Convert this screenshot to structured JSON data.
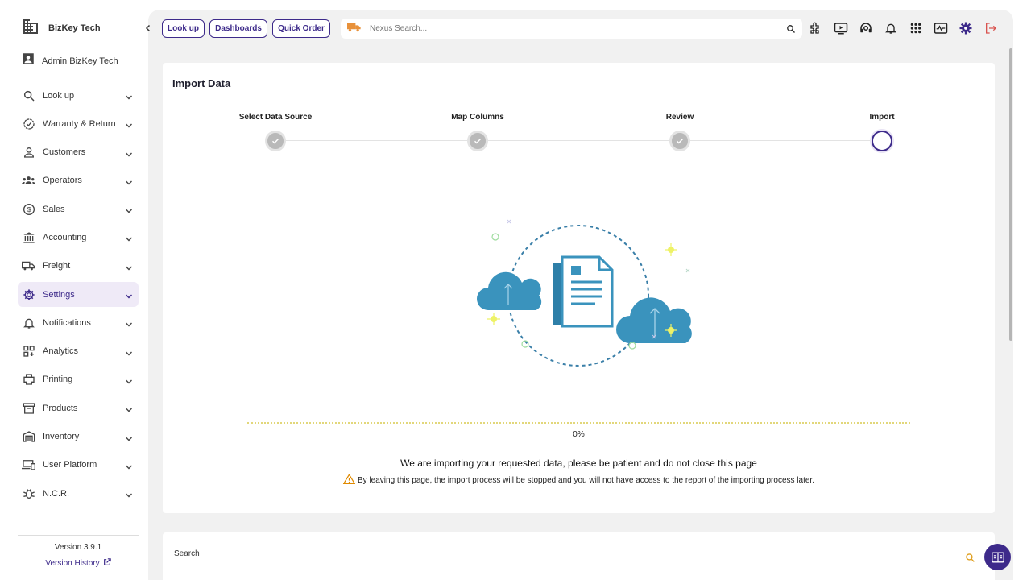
{
  "brand": {
    "name": "BizKey Tech"
  },
  "user": {
    "name": "Admin BizKey Tech"
  },
  "sidebar": {
    "items": [
      {
        "label": "Look up",
        "icon": "search-icon"
      },
      {
        "label": "Warranty & Return",
        "icon": "badge-check-icon"
      },
      {
        "label": "Customers",
        "icon": "person-icon"
      },
      {
        "label": "Operators",
        "icon": "group-icon"
      },
      {
        "label": "Sales",
        "icon": "dollar-icon"
      },
      {
        "label": "Accounting",
        "icon": "bank-icon"
      },
      {
        "label": "Freight",
        "icon": "truck-icon"
      },
      {
        "label": "Settings",
        "icon": "gear-icon",
        "active": true
      },
      {
        "label": "Notifications",
        "icon": "bell-icon"
      },
      {
        "label": "Analytics",
        "icon": "grid-plus-icon"
      },
      {
        "label": "Printing",
        "icon": "printer-icon"
      },
      {
        "label": "Products",
        "icon": "archive-icon"
      },
      {
        "label": "Inventory",
        "icon": "warehouse-icon"
      },
      {
        "label": "User Platform",
        "icon": "devices-icon"
      },
      {
        "label": "N.C.R.",
        "icon": "bug-icon"
      }
    ],
    "version": "Version 3.9.1",
    "version_history": "Version History"
  },
  "topbar": {
    "lookup_label": "Look up",
    "dashboards_label": "Dashboards",
    "quick_order_label": "Quick Order",
    "search_placeholder": "Nexus Search..."
  },
  "import": {
    "title": "Import Data",
    "steps": [
      {
        "label": "Select Data Source",
        "status": "done"
      },
      {
        "label": "Map Columns",
        "status": "done"
      },
      {
        "label": "Review",
        "status": "done"
      },
      {
        "label": "Import",
        "status": "current"
      }
    ],
    "progress_text": "0%",
    "progress_value": 0,
    "message": "We are importing your requested data, please be patient and do not close this page",
    "warning": "By leaving this page, the import process will be stopped and you will not have access to the report of the importing process later."
  },
  "search_panel": {
    "label": "Search"
  },
  "colors": {
    "accent": "#3d2a8a",
    "illustration": "#3a93bd",
    "warning": "#e08a00"
  }
}
